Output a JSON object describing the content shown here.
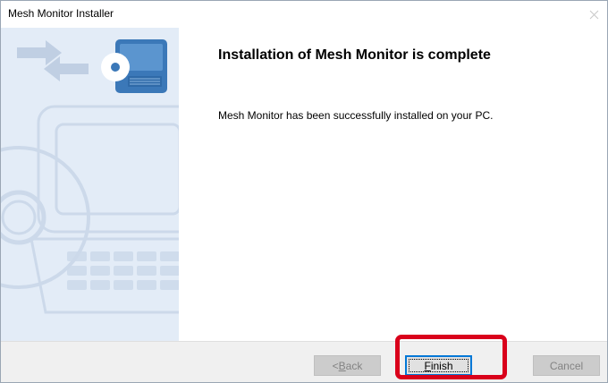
{
  "window": {
    "title": "Mesh Monitor Installer"
  },
  "content": {
    "heading": "Installation of Mesh Monitor is complete",
    "message": "Mesh Monitor has been successfully installed on your PC."
  },
  "buttons": {
    "back": {
      "prefix": "< ",
      "mnemonic": "B",
      "rest": "ack",
      "enabled": false
    },
    "finish": {
      "mnemonic": "F",
      "rest": "inish",
      "enabled": true,
      "focused": true
    },
    "cancel": {
      "label": "Cancel",
      "enabled": false
    }
  },
  "icons": {
    "close": "close-icon",
    "computer": "computer-disc-icon",
    "arrows": "transfer-arrows-icon"
  },
  "colors": {
    "side_panel": "#e3ecf7",
    "accent": "#0078d7",
    "highlight": "#d9001b"
  }
}
